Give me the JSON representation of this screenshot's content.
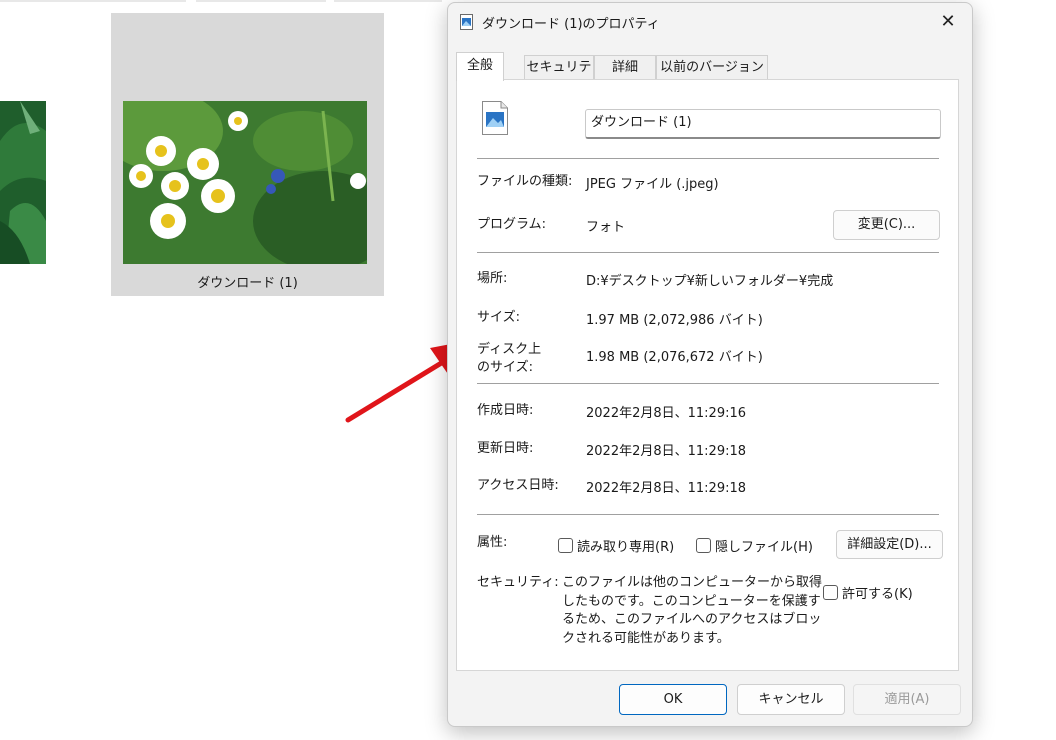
{
  "explorer": {
    "selected_item_label": "ダウンロード (1)"
  },
  "dialog": {
    "title": "ダウンロード (1)のプロパティ",
    "tabs": [
      {
        "label": "全般"
      },
      {
        "label": "セキュリティ"
      },
      {
        "label": "詳細"
      },
      {
        "label": "以前のバージョン"
      }
    ],
    "filename": "ダウンロード (1)",
    "file_type": {
      "label": "ファイルの種類:",
      "value": "JPEG ファイル (.jpeg)"
    },
    "program": {
      "label": "プログラム:",
      "value": "フォト",
      "change_button": "変更(C)..."
    },
    "location": {
      "label": "場所:",
      "value": "D:¥デスクトップ¥新しいフォルダー¥完成"
    },
    "size": {
      "label": "サイズ:",
      "value": "1.97 MB (2,072,986 バイト)"
    },
    "size_on_disk": {
      "label": "ディスク上\nのサイズ:",
      "value": "1.98 MB (2,076,672 バイト)"
    },
    "created": {
      "label": "作成日時:",
      "value": "2022年2月8日、11:29:16"
    },
    "modified": {
      "label": "更新日時:",
      "value": "2022年2月8日、11:29:18"
    },
    "accessed": {
      "label": "アクセス日時:",
      "value": "2022年2月8日、11:29:18"
    },
    "attributes": {
      "label": "属性:",
      "readonly": "読み取り専用(R)",
      "hidden": "隠しファイル(H)",
      "advanced_button": "詳細設定(D)..."
    },
    "security": {
      "label": "セキュリティ:",
      "text": "このファイルは他のコンピューターから取得したものです。このコンピューターを保護するため、このファイルへのアクセスはブロックされる可能性があります。",
      "allow": "許可する(K)"
    },
    "buttons": {
      "ok": "OK",
      "cancel": "キャンセル",
      "apply": "適用(A)"
    }
  },
  "colors": {
    "accent": "#0067c0",
    "arrow": "#e0151a",
    "selection": "#d9d9d9"
  }
}
